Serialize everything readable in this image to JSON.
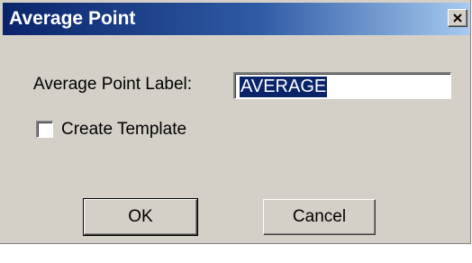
{
  "dialog": {
    "title": "Average Point",
    "close_icon": "close-icon",
    "average_point_label": {
      "label": "Average Point Label:",
      "value": "AVERAGE"
    },
    "create_template": {
      "label": "Create Template",
      "checked": false
    },
    "buttons": {
      "ok_label": "OK",
      "cancel_label": "Cancel"
    },
    "colors": {
      "titlebar_start": "#0a246a",
      "titlebar_end": "#a6caf0",
      "face": "#d4d0c8",
      "selection": "#0a246a"
    }
  }
}
